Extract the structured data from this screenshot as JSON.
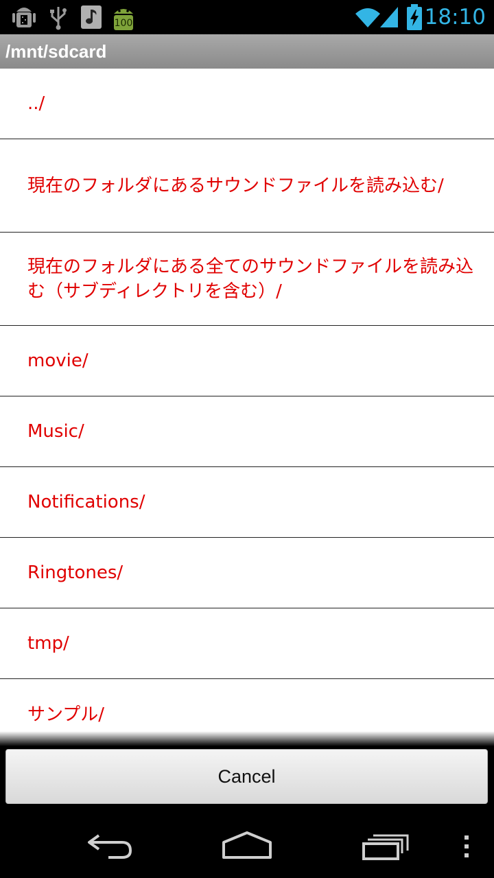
{
  "status_bar": {
    "time": "18:10",
    "battery_badge": "100",
    "left_icons": [
      "android-debug-icon",
      "usb-icon",
      "music-note-icon",
      "android-battery-icon"
    ],
    "right_icons": [
      "wifi-icon",
      "signal-icon",
      "battery-charging-icon"
    ],
    "accent_color": "#33b5e5"
  },
  "title_bar": {
    "path": "/mnt/sdcard"
  },
  "file_list": {
    "items": [
      "../",
      "現在のフォルダにあるサウンドファイルを読み込む/",
      "現在のフォルダにある全てのサウンドファイルを読み込む（サブディレクトリを含む）/",
      "movie/",
      "Music/",
      "Notifications/",
      "Ringtones/",
      "tmp/",
      "サンプル/"
    ],
    "text_color": "#e00000"
  },
  "cancel_label": "Cancel",
  "nav_bar": {
    "icons": [
      "back-icon",
      "home-icon",
      "recent-apps-icon",
      "overflow-menu-icon"
    ]
  }
}
